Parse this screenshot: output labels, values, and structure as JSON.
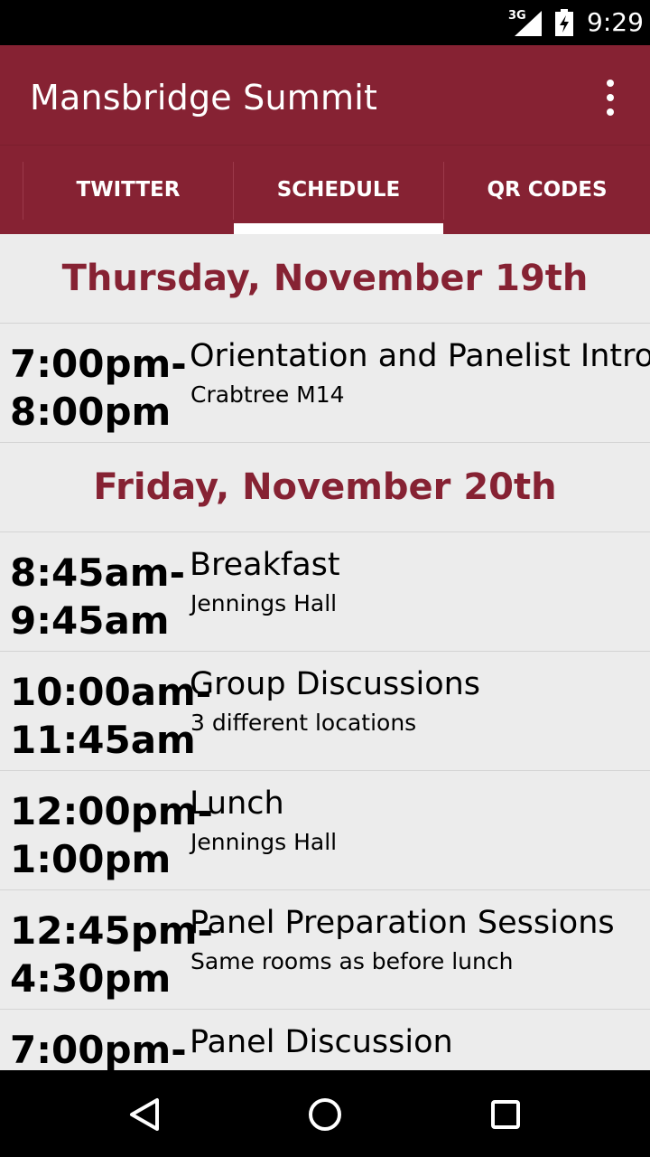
{
  "status_bar": {
    "network": "3G",
    "time": "9:29"
  },
  "app_bar": {
    "title": "Mansbridge Summit",
    "menu_icon": "more-vert-icon"
  },
  "tabs": [
    {
      "label": "TWITTER",
      "selected": false
    },
    {
      "label": "SCHEDULE",
      "selected": true
    },
    {
      "label": "QR CODES",
      "selected": false
    }
  ],
  "schedule": {
    "day1": {
      "heading": "Thursday, November 19th",
      "events": [
        {
          "time": "7:00pm-\n8:00pm",
          "title": "Orientation and Panelist Intros",
          "location": "Crabtree M14"
        }
      ]
    },
    "day2": {
      "heading": "Friday, November 20th",
      "events": [
        {
          "time": "8:45am-\n9:45am",
          "title": "Breakfast",
          "location": "Jennings Hall"
        },
        {
          "time": "10:00am-\n11:45am",
          "title": "Group Discussions",
          "location": "3 different locations"
        },
        {
          "time": "12:00pm-\n1:00pm",
          "title": "Lunch",
          "location": "Jennings Hall"
        },
        {
          "time": "12:45pm-\n4:30pm",
          "title": "Panel Preparation Sessions",
          "location": "Same rooms as before lunch"
        },
        {
          "time": "7:00pm-",
          "title": "Panel Discussion",
          "location": ""
        }
      ]
    }
  },
  "nav_bar": {
    "back": "back-icon",
    "home": "home-icon",
    "recents": "recents-icon"
  },
  "colors": {
    "primary": "#862233",
    "background": "#ececec"
  }
}
